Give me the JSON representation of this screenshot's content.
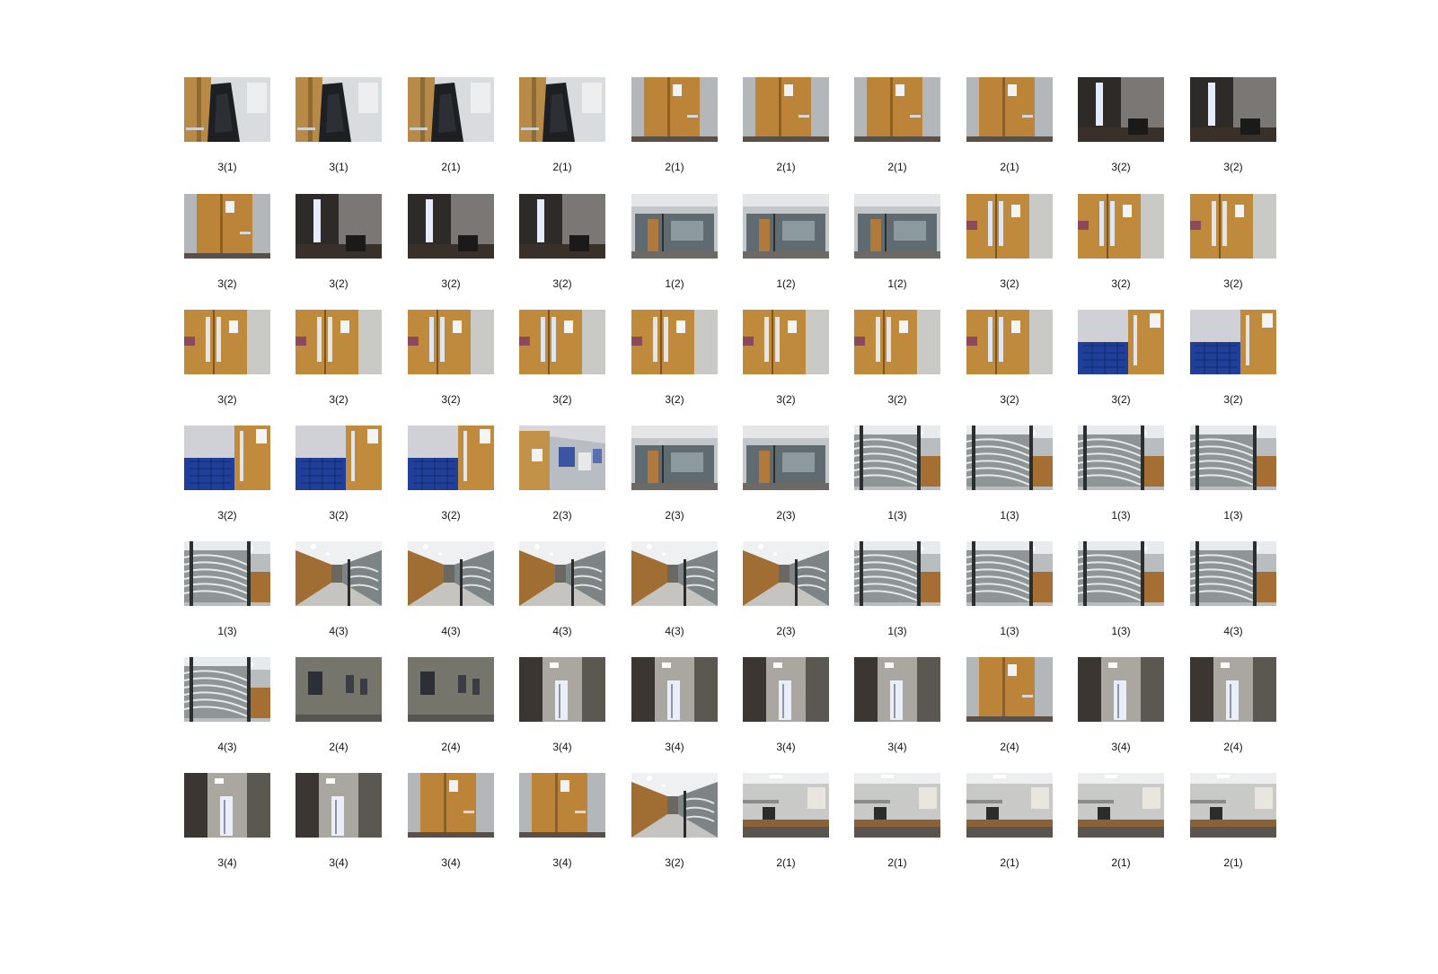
{
  "figure": {
    "rows": 7,
    "columns": 10,
    "captions": [
      "3(1)",
      "3(1)",
      "2(1)",
      "2(1)",
      "2(1)",
      "2(1)",
      "2(1)",
      "2(1)",
      "3(2)",
      "3(2)",
      "3(2)",
      "3(2)",
      "3(2)",
      "3(2)",
      "1(2)",
      "1(2)",
      "1(2)",
      "3(2)",
      "3(2)",
      "3(2)",
      "3(2)",
      "3(2)",
      "3(2)",
      "3(2)",
      "3(2)",
      "3(2)",
      "3(2)",
      "3(2)",
      "3(2)",
      "3(2)",
      "3(2)",
      "3(2)",
      "3(2)",
      "2(3)",
      "2(3)",
      "2(3)",
      "1(3)",
      "1(3)",
      "1(3)",
      "1(3)",
      "1(3)",
      "4(3)",
      "4(3)",
      "4(3)",
      "4(3)",
      "2(3)",
      "1(3)",
      "1(3)",
      "1(3)",
      "4(3)",
      "4(3)",
      "2(4)",
      "2(4)",
      "3(4)",
      "3(4)",
      "3(4)",
      "3(4)",
      "2(4)",
      "3(4)",
      "2(4)",
      "3(4)",
      "3(4)",
      "3(4)",
      "3(4)",
      "3(2)",
      "2(1)",
      "2(1)",
      "2(1)",
      "2(1)",
      "2(1)"
    ],
    "scenes": [
      "coat-door",
      "coat-door",
      "coat-door",
      "coat-door",
      "wood-door",
      "wood-door",
      "wood-door",
      "wood-door",
      "dark-room-window",
      "dark-room-window",
      "wood-door",
      "dark-room-window",
      "dark-room-window",
      "dark-room-window",
      "glass-office",
      "glass-office",
      "glass-office",
      "double-door",
      "double-door",
      "double-door",
      "double-door",
      "double-door",
      "double-door",
      "double-door",
      "double-door",
      "double-door",
      "double-door",
      "double-door",
      "blue-lockers-door",
      "blue-lockers-door",
      "blue-lockers-door",
      "blue-lockers-door",
      "blue-lockers-door",
      "noticeboard",
      "glass-office",
      "glass-office",
      "glass-blinds",
      "glass-blinds",
      "glass-blinds",
      "glass-blinds",
      "glass-blinds",
      "corridor",
      "corridor",
      "corridor",
      "corridor",
      "corridor",
      "glass-blinds",
      "glass-blinds",
      "glass-blinds",
      "glass-blinds",
      "glass-blinds",
      "grey-wall",
      "grey-wall",
      "corridor-window",
      "corridor-window",
      "corridor-window",
      "corridor-window",
      "wood-door",
      "corridor-window",
      "corridor-window",
      "corridor-window",
      "corridor-window",
      "wood-door",
      "wood-door",
      "corridor",
      "office-desk",
      "office-desk",
      "office-desk",
      "office-desk",
      "office-desk"
    ]
  }
}
